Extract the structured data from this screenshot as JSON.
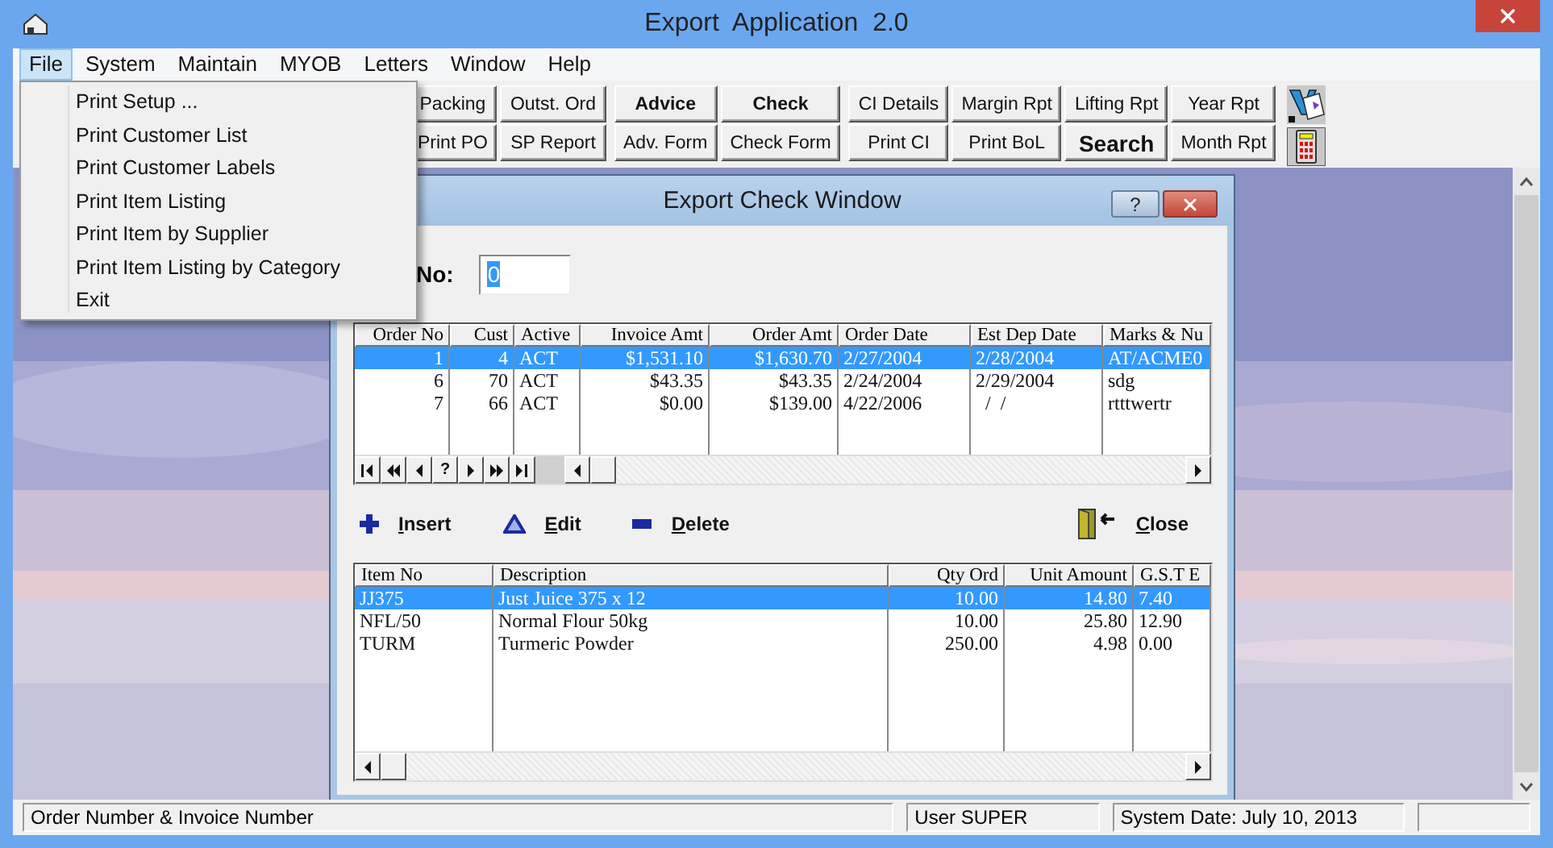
{
  "window": {
    "title": "Export  Application  2.0"
  },
  "menu_bar": [
    {
      "label": "File",
      "selected": true
    },
    {
      "label": "System",
      "selected": false
    },
    {
      "label": "Maintain",
      "selected": false
    },
    {
      "label": "MYOB",
      "selected": false
    },
    {
      "label": "Letters",
      "selected": false
    },
    {
      "label": "Window",
      "selected": false
    },
    {
      "label": "Help",
      "selected": false
    }
  ],
  "file_menu": [
    "Print Setup ...",
    "Print Customer List",
    "Print Customer Labels",
    "Print Item Listing",
    "Print Item by Supplier",
    "Print Item Listing by Category",
    "Exit"
  ],
  "toolbar_groups": [
    [
      [
        {
          "label": "Packing",
          "kind": "normal"
        },
        {
          "label": "Print PO",
          "kind": "normal"
        }
      ],
      [
        {
          "label": "Outst. Ord",
          "kind": "normal"
        },
        {
          "label": "SP Report",
          "kind": "normal"
        }
      ]
    ],
    [
      [
        {
          "label": "Advice",
          "kind": "bold"
        },
        {
          "label": "Adv. Form",
          "kind": "normal"
        }
      ],
      [
        {
          "label": "Check",
          "kind": "bold"
        },
        {
          "label": "Check Form",
          "kind": "normal"
        }
      ]
    ],
    [
      [
        {
          "label": "CI Details",
          "kind": "normal"
        },
        {
          "label": "Print CI",
          "kind": "normal"
        }
      ],
      [
        {
          "label": "Margin Rpt",
          "kind": "normal"
        },
        {
          "label": "Print BoL",
          "kind": "normal"
        }
      ],
      [
        {
          "label": "Lifting Rpt",
          "kind": "normal"
        },
        {
          "label": "Search",
          "kind": "large"
        }
      ],
      [
        {
          "label": "Year Rpt",
          "kind": "normal"
        },
        {
          "label": "Month Rpt",
          "kind": "normal"
        }
      ]
    ]
  ],
  "child_window": {
    "title": "Export Check Window",
    "help_label": "?",
    "order_label": "No:",
    "order_value": "0",
    "orders": {
      "columns": [
        "Order No",
        "Cust",
        "Active",
        "Invoice Amt",
        "Order Amt",
        "Order Date",
        "Est Dep Date",
        "Marks & Nu"
      ],
      "rows": [
        {
          "cells": [
            "1",
            "4",
            "ACT",
            "$1,531.10",
            "$1,630.70",
            "2/27/2004",
            "2/28/2004",
            "AT/ACME0"
          ],
          "selected": true
        },
        {
          "cells": [
            "6",
            "70",
            "ACT",
            "$43.35",
            "$43.35",
            "2/24/2004",
            "2/29/2004",
            "sdg"
          ],
          "selected": false
        },
        {
          "cells": [
            "7",
            "66",
            "ACT",
            "$0.00",
            "$139.00",
            "4/22/2006",
            "  /  /",
            "rtttwertr"
          ],
          "selected": false
        }
      ]
    },
    "nav_buttons": [
      {
        "kind": "first"
      },
      {
        "kind": "prev_page"
      },
      {
        "kind": "prev"
      },
      {
        "kind": "help",
        "label": "?"
      },
      {
        "kind": "next"
      },
      {
        "kind": "next_page"
      },
      {
        "kind": "last"
      }
    ],
    "actions": [
      {
        "label": "Insert",
        "kind": "insert"
      },
      {
        "label": "Edit",
        "kind": "edit"
      },
      {
        "label": "Delete",
        "kind": "delete"
      }
    ],
    "close_label": "Close",
    "items": {
      "columns": [
        "Item No",
        "Description",
        "Qty Ord",
        "Unit Amount",
        "G.S.T E"
      ],
      "rows": [
        {
          "cells": [
            "JJ375",
            "Just Juice 375 x 12",
            "10.00",
            "14.80",
            "7.40"
          ],
          "selected": true
        },
        {
          "cells": [
            "NFL/50",
            "Normal Flour 50kg",
            "10.00",
            "25.80",
            "12.90"
          ],
          "selected": false
        },
        {
          "cells": [
            "TURM",
            "Turmeric Powder",
            "250.00",
            "4.98",
            "0.00"
          ],
          "selected": false
        }
      ]
    }
  },
  "status_bar": [
    "Order Number & Invoice Number",
    "User SUPER",
    "System Date: July 10, 2013"
  ]
}
